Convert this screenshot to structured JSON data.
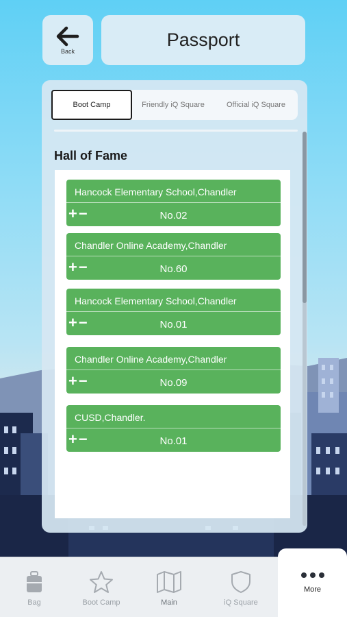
{
  "header": {
    "back_label": "Back",
    "title": "Passport"
  },
  "tabs": [
    {
      "label": "Boot Camp",
      "active": true
    },
    {
      "label": "Friendly iQ Square",
      "active": false
    },
    {
      "label": "Official iQ Square",
      "active": false
    }
  ],
  "hall_of_fame": {
    "title": "Hall of Fame",
    "entries": [
      {
        "school": "Hancock Elementary School,Chandler",
        "rank": "No.02",
        "controls": "+−"
      },
      {
        "school": "Chandler Online Academy,Chandler",
        "rank": "No.60",
        "controls": "+−"
      },
      {
        "school": "Hancock Elementary School,Chandler",
        "rank": "No.01",
        "controls": "+−"
      },
      {
        "school": "Chandler Online Academy,Chandler",
        "rank": "No.09",
        "controls": "+−"
      },
      {
        "school": "CUSD,Chandler.",
        "rank": "No.01",
        "controls": "+−"
      }
    ]
  },
  "bottom_nav": [
    {
      "label": "Bag",
      "icon": "bag-icon"
    },
    {
      "label": "Boot Camp",
      "icon": "star-icon"
    },
    {
      "label": "Main",
      "icon": "map-icon"
    },
    {
      "label": "iQ Square",
      "icon": "shield-icon"
    },
    {
      "label": "More",
      "icon": "more-dots-icon",
      "active": true
    }
  ],
  "colors": {
    "card_green": "#59b25c",
    "panel_bg": "#d6e7f2",
    "sky_top": "#5fd0f5"
  }
}
